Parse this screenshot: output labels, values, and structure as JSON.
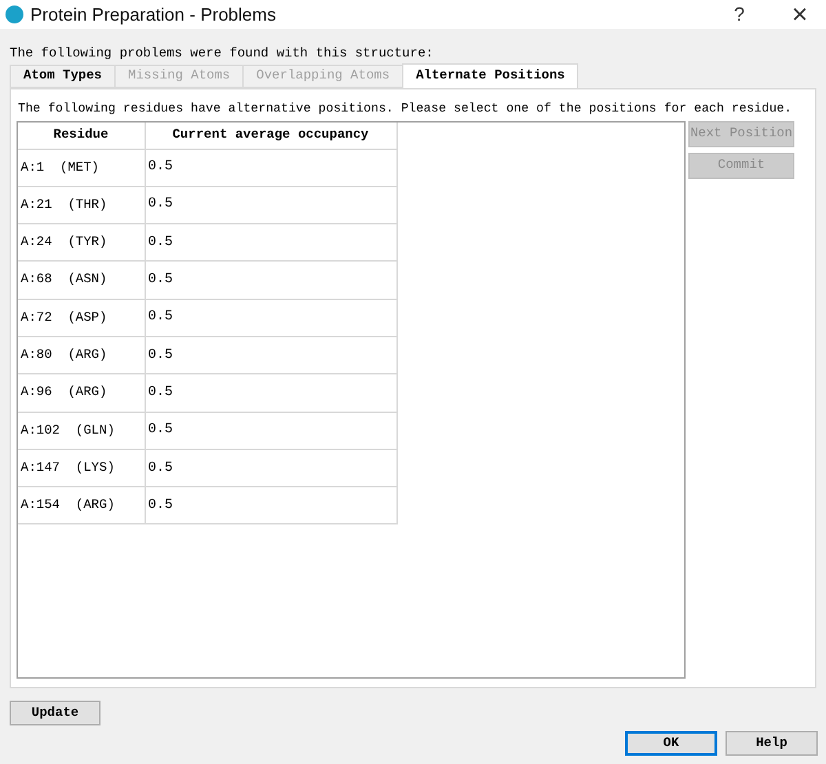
{
  "window": {
    "title": "Protein Preparation - Problems",
    "help": "?",
    "close": "×"
  },
  "intro": "The following problems were found with this structure:",
  "tabs": [
    {
      "label": "Atom Types",
      "selected": false,
      "disabled": false
    },
    {
      "label": "Missing Atoms",
      "selected": false,
      "disabled": true
    },
    {
      "label": "Overlapping Atoms",
      "selected": false,
      "disabled": true
    },
    {
      "label": "Alternate Positions",
      "selected": true,
      "disabled": false
    }
  ],
  "panel_text": "The following residues have alternative positions. Please select one of the positions for each residue.",
  "table": {
    "columns": [
      "Residue",
      "Current average occupancy"
    ],
    "rows": [
      [
        "A:1  (MET)",
        "0.5"
      ],
      [
        "A:21  (THR)",
        "0.5"
      ],
      [
        "A:24  (TYR)",
        "0.5"
      ],
      [
        "A:68  (ASN)",
        "0.5"
      ],
      [
        "A:72  (ASP)",
        "0.5"
      ],
      [
        "A:80  (ARG)",
        "0.5"
      ],
      [
        "A:96  (ARG)",
        "0.5"
      ],
      [
        "A:102  (GLN)",
        "0.5"
      ],
      [
        "A:147  (LYS)",
        "0.5"
      ],
      [
        "A:154  (ARG)",
        "0.5"
      ]
    ]
  },
  "side_buttons": [
    {
      "label": "Next Position",
      "disabled": true
    },
    {
      "label": "Commit",
      "disabled": true
    }
  ],
  "update_button": "Update",
  "dialog_buttons": [
    {
      "label": "OK",
      "default": true
    },
    {
      "label": "Help",
      "default": false
    }
  ]
}
